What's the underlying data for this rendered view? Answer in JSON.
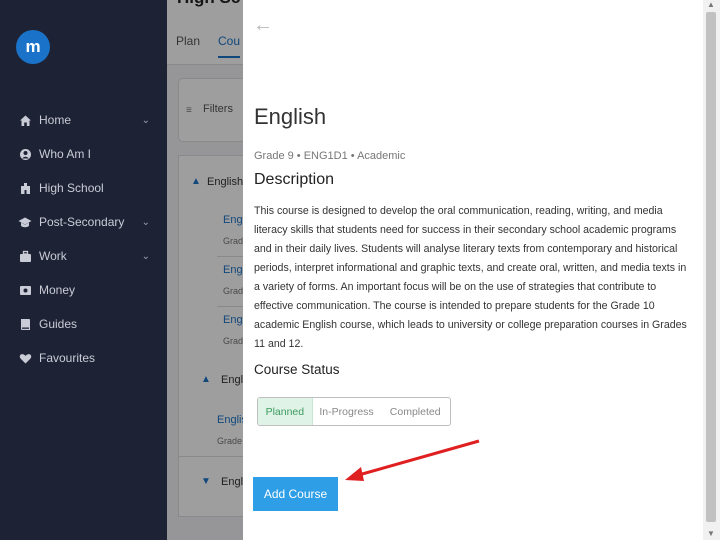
{
  "sidebar": {
    "logo_text": "m",
    "items": [
      {
        "label": "Home",
        "icon": "home-icon",
        "has_chevron": true
      },
      {
        "label": "Who Am I",
        "icon": "person-circle-icon",
        "has_chevron": false
      },
      {
        "label": "High School",
        "icon": "school-icon",
        "has_chevron": false
      },
      {
        "label": "Post-Secondary",
        "icon": "graduation-cap-icon",
        "has_chevron": true
      },
      {
        "label": "Work",
        "icon": "briefcase-icon",
        "has_chevron": true
      },
      {
        "label": "Money",
        "icon": "money-icon",
        "has_chevron": false
      },
      {
        "label": "Guides",
        "icon": "book-icon",
        "has_chevron": false
      },
      {
        "label": "Favourites",
        "icon": "heart-icon",
        "has_chevron": false
      }
    ]
  },
  "background_page": {
    "title": "High Sc",
    "tabs": [
      "Plan",
      "Cou"
    ],
    "filters_label": "Filters",
    "groups": [
      {
        "label": "English",
        "collapsed": false
      },
      {
        "label": "Engli",
        "collapsed": false
      },
      {
        "label": "Engli",
        "collapsed": true
      }
    ],
    "course_links": [
      "Engl",
      "Engl",
      "Engl",
      "Englis"
    ],
    "course_subs": [
      "Grad",
      "Grad",
      "Grad",
      "Grade S"
    ]
  },
  "drawer": {
    "course_title": "English",
    "meta": "Grade 9 • ENG1D1 • Academic",
    "description_heading": "Description",
    "description": "This course is designed to develop the oral communication, reading, writing, and media literacy skills that students need for success in their secondary school academic programs and in their daily lives. Students will analyse literary texts from contemporary and historical periods, interpret informational and graphic texts, and create oral, written, and media texts in a variety of forms. An important focus will be on the use of strategies that contribute to effective communication. The course is intended to prepare students for the Grade 10 academic English course, which leads to university or college preparation courses in Grades 11 and 12.",
    "status_heading": "Course Status",
    "status_options": [
      "Planned",
      "In-Progress",
      "Completed"
    ],
    "status_selected": "Planned",
    "add_button_label": "Add Course"
  },
  "colors": {
    "sidebar_bg": "#1e2235",
    "accent": "#2e9ee6",
    "selected_status_bg": "#dff4e7",
    "annotation_arrow": "#e02020"
  }
}
